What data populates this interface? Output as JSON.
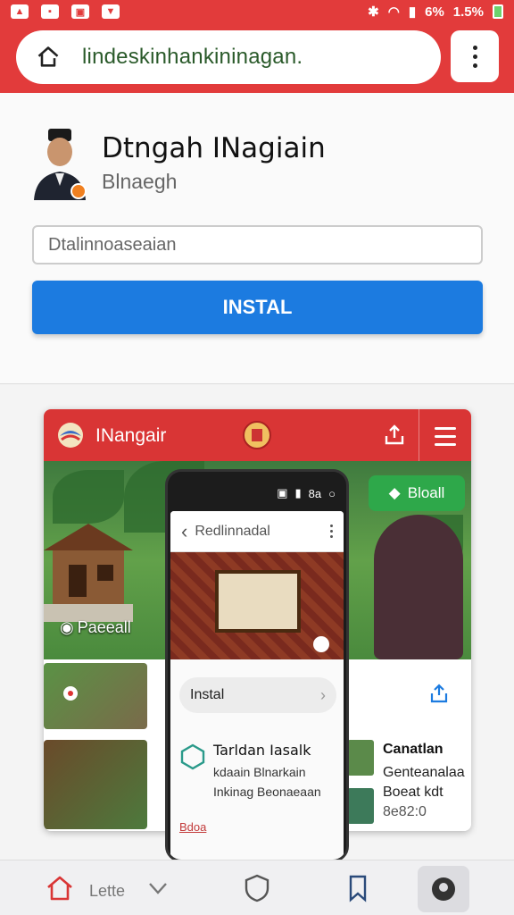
{
  "status_bar": {
    "percent": "6%",
    "battery": "1.5%"
  },
  "browser": {
    "url": "lindeskinhankininagan."
  },
  "profile": {
    "title": "Dtngah INagiain",
    "subtitle": "Blnaegh"
  },
  "search": {
    "placeholder": "Dtalinnoaseaian"
  },
  "install_button": "INSTAL",
  "site": {
    "name": "INangair",
    "hero_label": "Paeeall",
    "hero_pill": "Bloall"
  },
  "phone": {
    "status": "8a",
    "bar_title": "Redlinnadal",
    "install_label": "Instal",
    "item_title": "Tarldan Iasalk",
    "item_lines": [
      "kdaain Blnarkain",
      "Inkinag Beonaeaan"
    ],
    "link": "Bdoa"
  },
  "side_card": {
    "title": "Canatlan",
    "lines": [
      "Genteanalaa",
      "Boeat kdt",
      "8e82:0"
    ]
  },
  "bottom_nav": {
    "label": "Lette"
  },
  "colors": {
    "brand_red": "#e23b3b",
    "install_blue": "#1c7be0",
    "pill_green": "#2ea84a"
  }
}
